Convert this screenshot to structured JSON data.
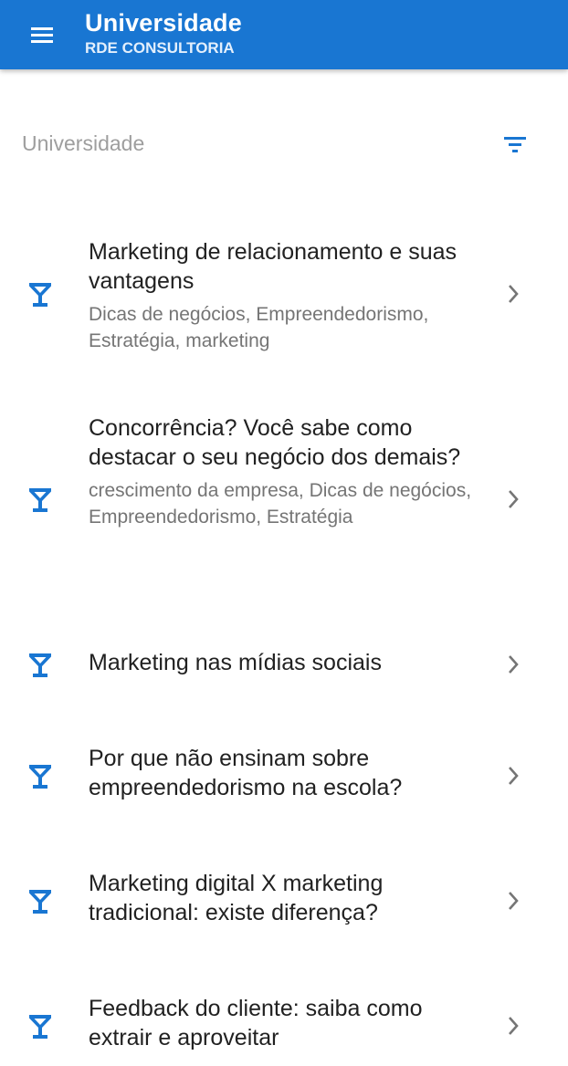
{
  "appbar": {
    "title": "Universidade",
    "subtitle": "RDE CONSULTORIA",
    "menu_icon": "menu-icon",
    "color": "#1976d2"
  },
  "search": {
    "label": "Universidade",
    "filter_icon": "filter-icon"
  },
  "items": [
    {
      "title": "Marketing de relacionamento e suas vantagens",
      "tags": "Dicas de negócios, Empreendedorismo, Estratégia, marketing",
      "icon": "cocktail-glass-icon"
    },
    {
      "title": "Concorrência? Você sabe como destacar o seu negócio dos demais?",
      "tags": "crescimento da empresa, Dicas de negócios, Empreendedorismo, Estratégia",
      "icon": "cocktail-glass-icon"
    },
    {
      "title": "Marketing nas mídias sociais",
      "tags": "",
      "icon": "cocktail-glass-icon"
    },
    {
      "title": "Por que não ensinam sobre empreendedorismo na escola?",
      "tags": "",
      "icon": "cocktail-glass-icon"
    },
    {
      "title": "Marketing digital X marketing tradicional: existe diferença?",
      "tags": "",
      "icon": "cocktail-glass-icon"
    },
    {
      "title": "Feedback do cliente: saiba como extrair e aproveitar",
      "tags": "",
      "icon": "cocktail-glass-icon"
    }
  ],
  "colors": {
    "accent": "#1976d2",
    "title_text": "#212121",
    "secondary_text": "#757575",
    "chevron": "#757575"
  }
}
